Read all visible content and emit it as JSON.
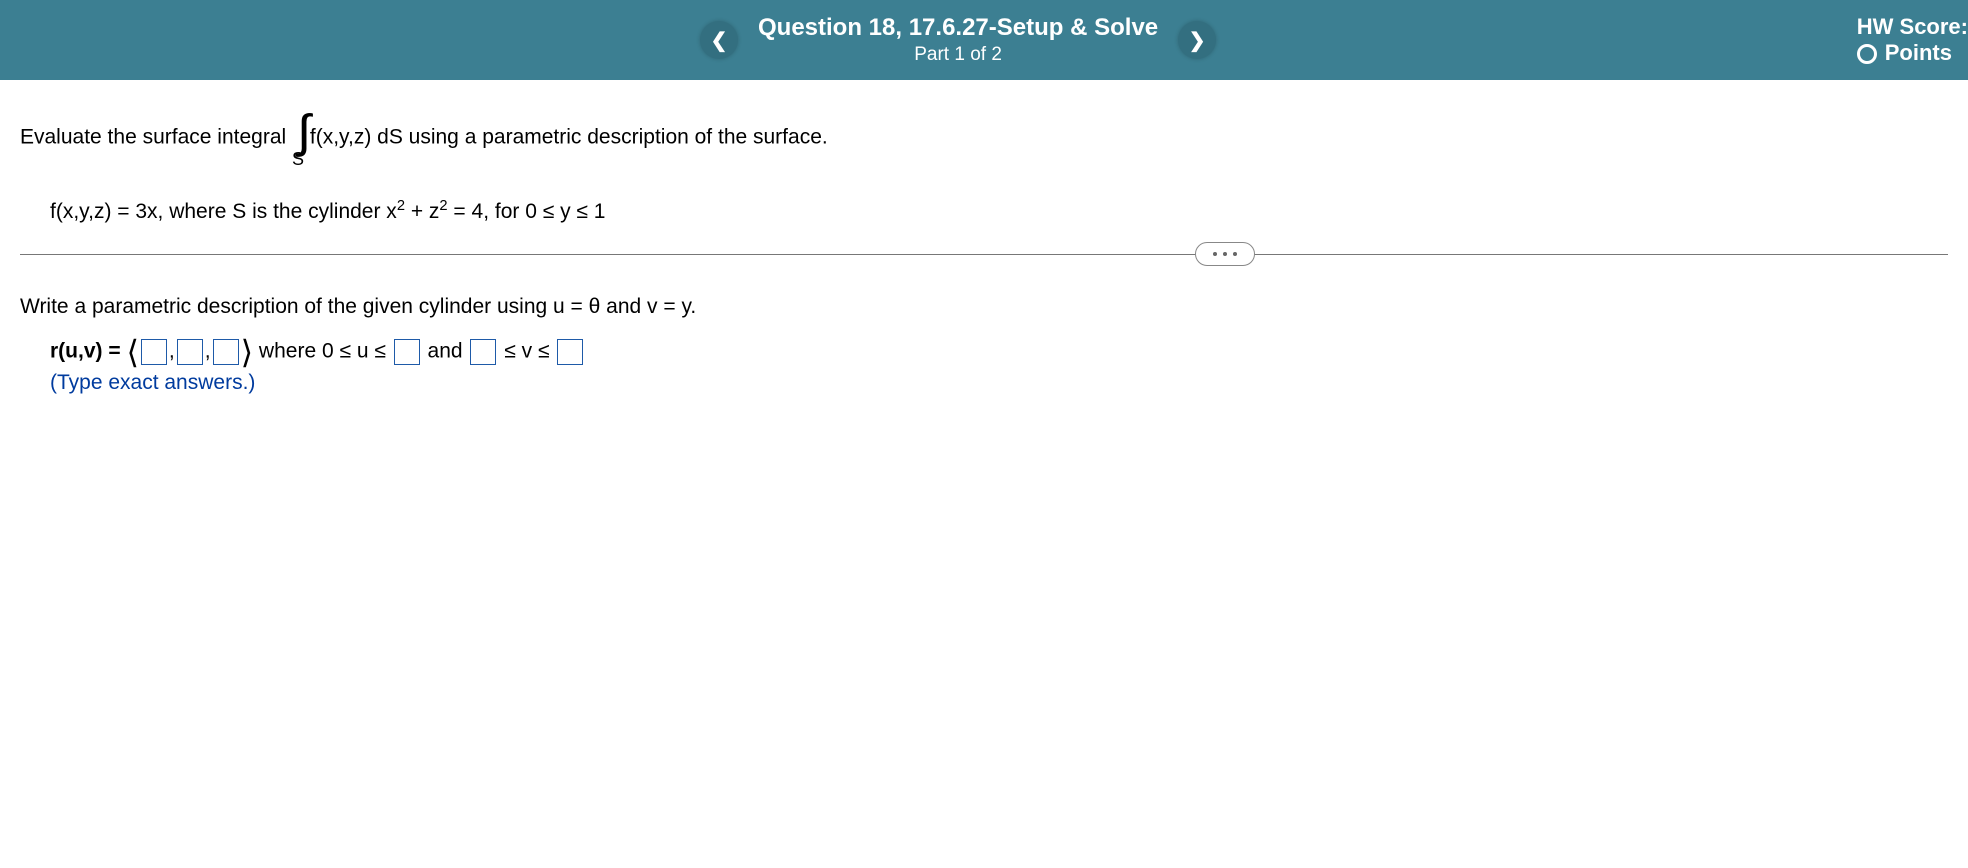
{
  "header": {
    "title": "Question 18, 17.6.27-Setup & Solve",
    "part": "Part 1 of 2",
    "hw_label": "HW Score:",
    "points_label": "Points"
  },
  "question": {
    "line1_a": "Evaluate the surface integral",
    "line1_b": "f(x,y,z) dS using a parametric description of the surface.",
    "integral_domain": "S",
    "line2_a": "f(x,y,z) = 3x, where S is the cylinder x",
    "line2_b": " + z",
    "line2_c": " = 4, for 0 ≤ y ≤ 1",
    "sup_2a": "2",
    "sup_2b": "2"
  },
  "prompt": {
    "text": "Write a parametric description of the given cylinder using u = θ and v = y."
  },
  "answer": {
    "r_label": "r(u,v) = ",
    "comma": ",",
    "where_a": " where 0 ≤ u ≤ ",
    "and": " and ",
    "vrange_a": " ≤ v ≤ ",
    "hint": "(Type exact answers.)"
  }
}
